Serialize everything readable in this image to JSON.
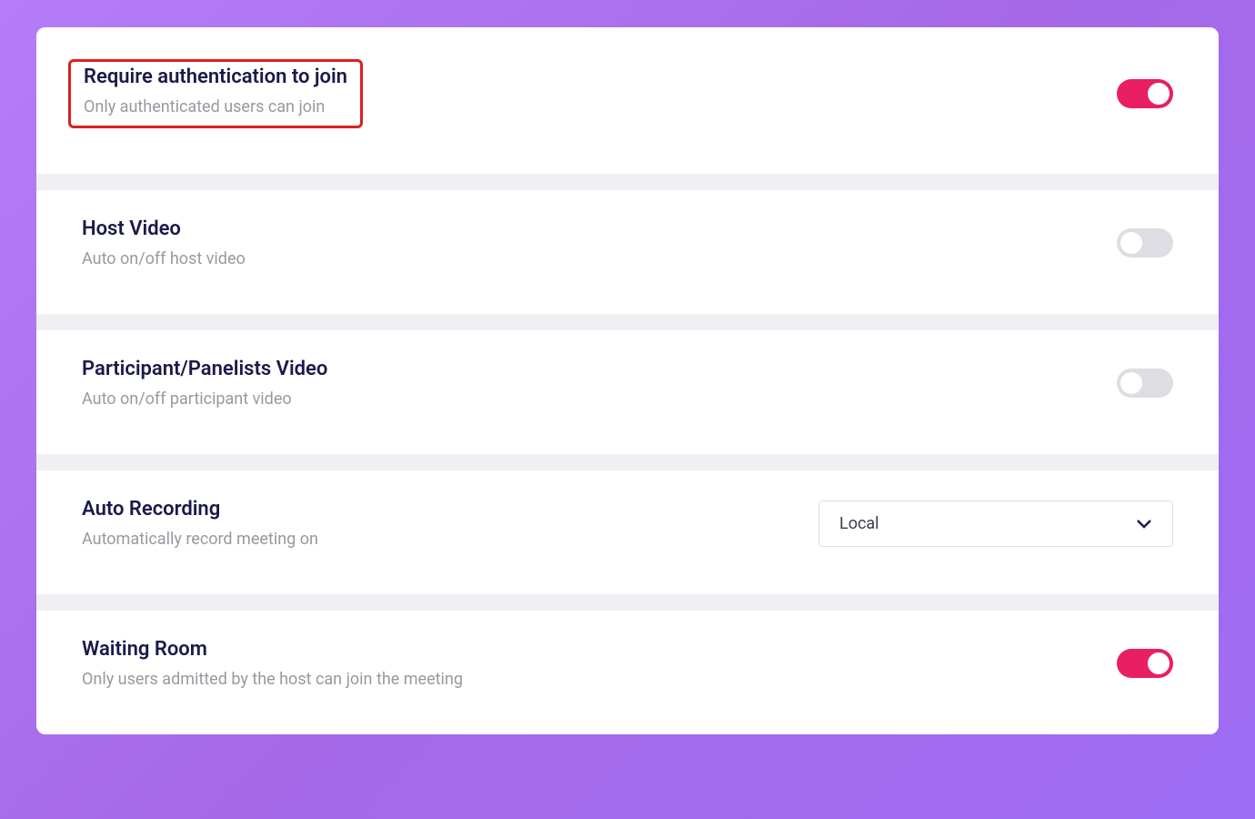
{
  "settings": {
    "authentication": {
      "title": "Require authentication to join",
      "description": "Only authenticated users can join",
      "enabled": true
    },
    "host_video": {
      "title": "Host Video",
      "description": "Auto on/off host video",
      "enabled": false
    },
    "participant_video": {
      "title": "Participant/Panelists Video",
      "description": "Auto on/off participant video",
      "enabled": false
    },
    "auto_recording": {
      "title": "Auto Recording",
      "description": "Automatically record meeting on",
      "selected": "Local"
    },
    "waiting_room": {
      "title": "Waiting Room",
      "description": "Only users admitted by the host can join the meeting",
      "enabled": true
    }
  }
}
